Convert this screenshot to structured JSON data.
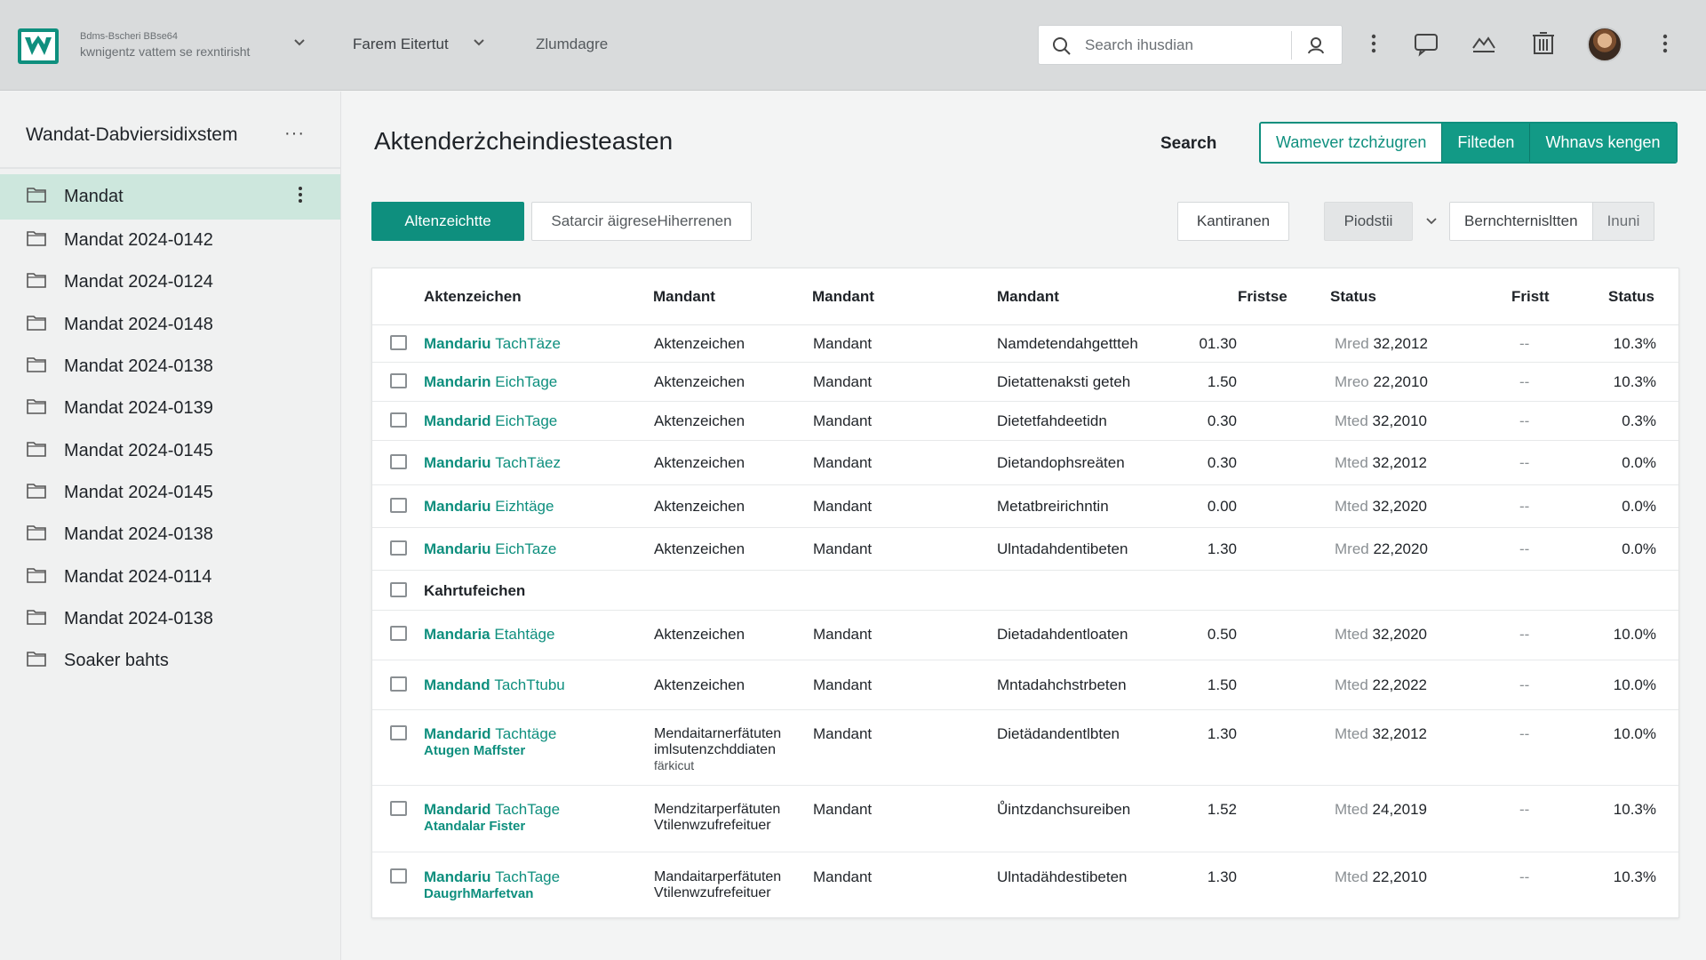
{
  "topbar": {
    "org_line1": "Bdms-Bscheri BBse64",
    "org_line2": "kwnigentz vattem se rexntirisht",
    "nav1": "Farem Eitertut",
    "nav2": "Zlumdagre",
    "search_placeholder": "Search ihusdian"
  },
  "sidebar": {
    "title": "Wandat-Dabviersidixstem",
    "more": "···",
    "items": [
      {
        "label": "Mandat"
      },
      {
        "label": "Mandat 2024-0142"
      },
      {
        "label": "Mandat 2024-0124"
      },
      {
        "label": "Mandat 2024-0148"
      },
      {
        "label": "Mandat 2024-0138"
      },
      {
        "label": "Mandat 2024-0139"
      },
      {
        "label": "Mandat 2024-0145"
      },
      {
        "label": "Mandat 2024-0145"
      },
      {
        "label": "Mandat 2024-0138"
      },
      {
        "label": "Mandat 2024-0114"
      },
      {
        "label": "Mandat 2024-0138"
      },
      {
        "label": "Soaker bahts"
      }
    ]
  },
  "main": {
    "title": "Aktenderżcheindiesteasten",
    "search_label": "Search",
    "group_buttons": [
      "Wamever tzchżugren",
      "Filteden",
      "Whnavs kengen"
    ],
    "primary_button": "Altenzeichtte",
    "secondary_button": "Satarcir äigreseHiherrenen",
    "kant_button": "Kantiranen",
    "select_value": "Piodstii",
    "seg_a": "Bernchternisltten",
    "seg_b": "Inuni"
  },
  "table": {
    "headers": [
      "Aktenzeichen",
      "Mandant",
      "Mandant",
      "Mandant",
      "Fristse",
      "Status",
      "Fristt",
      "Status"
    ],
    "rows": [
      {
        "c1a": "Mandariu",
        "c1b": "TachTäze",
        "c2": "Aktenzeichen",
        "c3": "Mandant",
        "c4": "Namdetendahgettteh",
        "c5": "01.30",
        "c6a": "Mred",
        "c6b": "32,2012",
        "c7": "--",
        "c8": "10.3%"
      },
      {
        "c1a": "Mandarin",
        "c1b": "EichTage",
        "c2": "Aktenzeichen",
        "c3": "Mandant",
        "c4": "Dietattenaksti geteh",
        "c5": "1.50",
        "c6a": "Mreo",
        "c6b": "22,2010",
        "c7": "--",
        "c8": "10.3%"
      },
      {
        "c1a": "Mandarid",
        "c1b": "EichTage",
        "c2": "Aktenzeichen",
        "c3": "Mandant",
        "c4": "Dietetfahdeetidn",
        "c5": "0.30",
        "c6a": "Mted",
        "c6b": "32,2010",
        "c7": "--",
        "c8": "0.3%"
      },
      {
        "c1a": "Mandariu",
        "c1b": "TachTäez",
        "c2": "Aktenzeichen",
        "c3": "Mandant",
        "c4": "Dietandophsreäten",
        "c5": "0.30",
        "c6a": "Mted",
        "c6b": "32,2012",
        "c7": "--",
        "c8": "0.0%"
      },
      {
        "c1a": "Mandariu",
        "c1b": "Eizhtäge",
        "c2": "Aktenzeichen",
        "c3": "Mandant",
        "c4": "Metatbreirichntin",
        "c5": "0.00",
        "c6a": "Mted",
        "c6b": "32,2020",
        "c7": "--",
        "c8": "0.0%"
      },
      {
        "c1a": "Mandariu",
        "c1b": "EichTaze",
        "c2": "Aktenzeichen",
        "c3": "Mandant",
        "c4": "Ulntadahdentibeten",
        "c5": "1.30",
        "c6a": "Mred",
        "c6b": "22,2020",
        "c7": "--",
        "c8": "0.0%"
      }
    ],
    "group_label": "Kahrtufeichen",
    "rows2": [
      {
        "c1a": "Mandaria",
        "c1b": "Etahtäge",
        "c2": "Aktenzeichen",
        "c3": "Mandant",
        "c4": "Dietadahdentloaten",
        "c5": "0.50",
        "c6a": "Mted",
        "c6b": "32,2020",
        "c7": "--",
        "c8": "10.0%"
      },
      {
        "c1a": "Mandand",
        "c1b": "TachTtubu",
        "c2": "Aktenzeichen",
        "c3": "Mandant",
        "c4": "Mntadahchstrbeten",
        "c5": "1.50",
        "c6a": "Mted",
        "c6b": "22,2022",
        "c7": "--",
        "c8": "10.0%"
      },
      {
        "c1a": "Mandarid",
        "c1b": "Tachtäge",
        "c1c": "Atugen Maffster",
        "c2a": "Mendaitarnerfätuten",
        "c2b": "imlsutenzchddiaten",
        "c2c": "färkicut",
        "c3": "Mandant",
        "c4": "Dietädandentlbten",
        "c5": "1.30",
        "c6a": "Mted",
        "c6b": "32,2012",
        "c7": "--",
        "c8": "10.0%"
      },
      {
        "c1a": "Mandarid",
        "c1b": "TachTage",
        "c1c": "Atandalar Fister",
        "c2a": "Mendzitarperfätuten",
        "c2b": "Vtilenwzufrefeituer",
        "c3": "Mandant",
        "c4": "Ůintzdanchsureiben",
        "c5": "1.52",
        "c6a": "Mted",
        "c6b": "24,2019",
        "c7": "--",
        "c8": "10.3%"
      },
      {
        "c1a": "Mandariu",
        "c1b": "TachTage",
        "c1c": "DaugrhMarfetvan",
        "c2a": "Mandaitarperfätuten",
        "c2b": "Vtilenwzufrefeituer",
        "c3": "Mandant",
        "c4": "Ulntadähdestibeten",
        "c5": "1.30",
        "c6a": "Mted",
        "c6b": "22,2010",
        "c7": "--",
        "c8": "10.3%"
      }
    ]
  },
  "colors": {
    "accent": "#0e8f7e",
    "active_row": "#cde7dd",
    "topbar": "#d9dbdc"
  }
}
